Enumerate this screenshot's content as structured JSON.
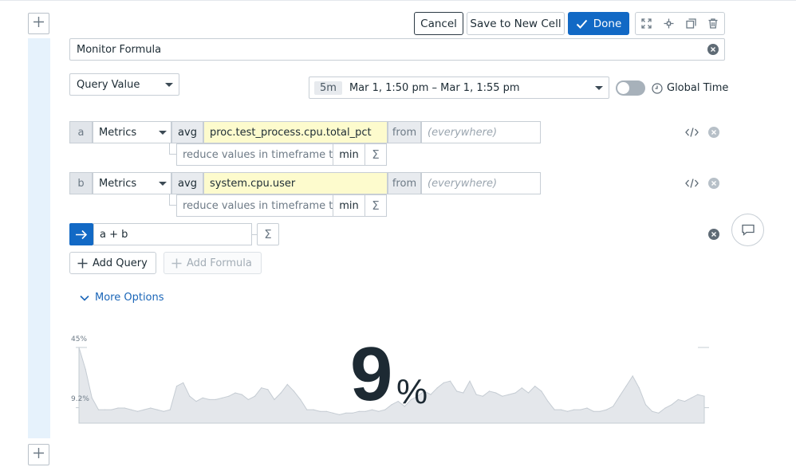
{
  "toolbar": {
    "cancel_label": "Cancel",
    "save_new_cell_label": "Save to New Cell",
    "done_label": "Done"
  },
  "title": {
    "value": "Monitor Formula"
  },
  "visualization": {
    "selected": "Query Value"
  },
  "timeframe": {
    "duration": "5m",
    "range": "Mar 1, 1:50 pm – Mar 1, 1:55 pm",
    "global_time_label": "Global Time",
    "global_time_enabled": false
  },
  "queries": [
    {
      "letter": "a",
      "source": "Metrics",
      "aggregator": "avg",
      "metric": "proc.test_process.cpu.total_pct",
      "from_label": "from",
      "from_placeholder": "(everywhere)",
      "reduce_label": "reduce values in timeframe to",
      "reduce_fn": "min",
      "sigma": "Σ"
    },
    {
      "letter": "b",
      "source": "Metrics",
      "aggregator": "avg",
      "metric": "system.cpu.user",
      "from_label": "from",
      "from_placeholder": "(everywhere)",
      "reduce_label": "reduce values in timeframe to",
      "reduce_fn": "min",
      "sigma": "Σ"
    }
  ],
  "formula": {
    "expression": "a + b",
    "sigma": "Σ"
  },
  "actions": {
    "add_query_label": "Add Query",
    "add_formula_label": "Add Formula",
    "add_formula_enabled": false,
    "more_options_label": "More Options"
  },
  "preview": {
    "value": "9",
    "unit": "%",
    "y_max_label": "45%",
    "y_mid_label": "9.2%"
  },
  "icons": {
    "plus": "plus-icon",
    "check": "check-icon",
    "expand": "expand-icon",
    "split": "split-icon",
    "clone": "clone-icon",
    "trash": "trash-icon",
    "clear": "clear-icon",
    "clock": "clock-icon",
    "code": "code-icon",
    "arrow": "arrow-right-icon",
    "chevron": "chevron-down-icon",
    "comment": "comment-icon"
  },
  "colors": {
    "primary": "#1269c5",
    "gutter": "#e6f2fc",
    "metric_highlight": "#fdfbcd",
    "sparkline_fill": "#e4e7eb",
    "sparkline_stroke": "#c5ccd3"
  },
  "chart_data": {
    "type": "area",
    "ylabel": "",
    "ylim": [
      0,
      45
    ],
    "y_ticks": [
      "45%",
      "9.2%"
    ],
    "values": [
      45,
      32,
      15,
      8,
      8,
      8,
      9,
      9,
      8,
      7,
      8,
      9,
      8,
      7,
      8,
      22,
      24,
      16,
      13,
      15,
      14,
      14,
      15,
      16,
      18,
      17,
      14,
      16,
      21,
      20,
      14,
      18,
      23,
      19,
      14,
      8,
      8,
      7,
      7,
      6,
      5,
      6,
      6,
      7,
      7,
      8,
      7,
      8,
      11,
      13,
      10,
      14,
      16,
      19,
      17,
      21,
      24,
      25,
      19,
      18,
      25,
      17,
      16,
      19,
      18,
      16,
      17,
      18,
      21,
      18,
      22,
      19,
      13,
      8,
      8,
      7,
      8,
      8,
      9,
      7,
      7,
      8,
      10,
      16,
      22,
      28,
      21,
      11,
      7,
      6,
      9,
      11,
      14,
      13,
      15,
      17,
      16
    ]
  }
}
